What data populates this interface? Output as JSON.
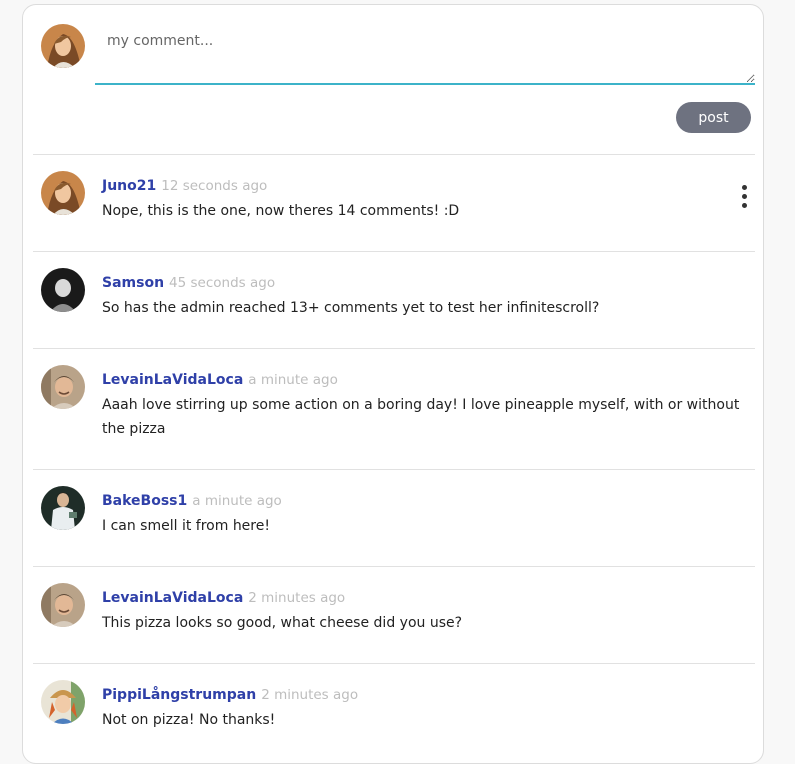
{
  "composer": {
    "placeholder": "my comment...",
    "post_label": "post"
  },
  "comments": [
    {
      "author": "Juno21",
      "time": "12 seconds ago",
      "text": "Nope, this is the one, now theres 14 comments! :D",
      "has_menu": true
    },
    {
      "author": "Samson",
      "time": "45 seconds ago",
      "text": "So has the admin reached 13+ comments yet to test her infinitescroll?"
    },
    {
      "author": "LevainLaVidaLoca",
      "time": "a minute ago",
      "text": "Aaah love stirring up some action on a boring day! I love pineapple myself, with or without the pizza"
    },
    {
      "author": "BakeBoss1",
      "time": "a minute ago",
      "text": "I can smell it from here!"
    },
    {
      "author": "LevainLaVidaLoca",
      "time": "2 minutes ago",
      "text": "This pizza looks so good, what cheese did you use?"
    },
    {
      "author": "PippiLångstrumpan",
      "time": "2 minutes ago",
      "text": "Not on pizza! No thanks!"
    }
  ],
  "colors": {
    "accent_underline": "#3cb3c9",
    "username": "#2f40a8",
    "post_button": "#6e7280"
  }
}
